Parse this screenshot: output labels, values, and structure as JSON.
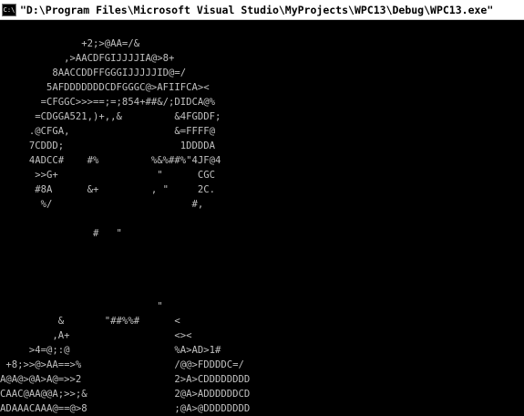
{
  "window": {
    "title": "\"D:\\Program Files\\Microsoft Visual Studio\\MyProjects\\WPC13\\Debug\\WPC13.exe\"",
    "icon": "console-icon",
    "icon_glyph": "C:\\"
  },
  "colors": {
    "console_background": "#000000",
    "console_text": "#c0c0c0",
    "titlebar_background": "#ffffff"
  },
  "console": {
    "lines": [
      "",
      "              +2;>@AA=/&",
      "           ,>AACDFGIJJJJIA@>8+",
      "         8AACCDDFFGGGIJJJJJID@=/",
      "        5AFDDDDDDDCDFGGGC@>AFIIFCA><",
      "       =CFGGC>>>==;=;854+##&/;DIDCA@%",
      "      =CDGGA521,)+,,&         &4FGDDF;",
      "     .@CFGA,                  &=FFFF@",
      "     7CDDD;                    1DDDDA",
      "     4ADCC#    #%         %&%##%\"4JF@4",
      "      >>G+                 \"      CGC",
      "      #8A      &+         , \"     2C.",
      "       %/                        #,",
      "",
      "                #   \"",
      "",
      "",
      "",
      "",
      "                           \"",
      "          &       \"##%%#      <",
      "         ,A+                  <>< ",
      "     >4=@;:@                  %A>AD>1#",
      " +8;>>@>AA==>%                /@@>FDDDDC=/",
      "A@A@>@A>A@=>>2                2>A>CDDDDDDDD",
      "CAAC@AA@@A;>>;&               2@A>ADDDDDDCD",
      "ADAAACAAA@==@>8               ;@A>@DDDDDDDD"
    ]
  }
}
